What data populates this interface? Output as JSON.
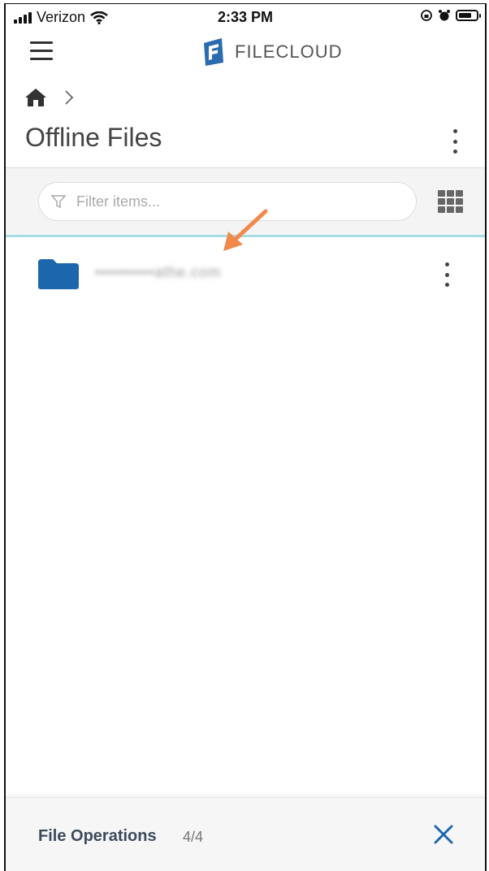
{
  "status_bar": {
    "carrier": "Verizon",
    "time": "2:33 PM"
  },
  "brand": {
    "name": "FILECLOUD"
  },
  "page": {
    "title": "Offline Files"
  },
  "filter": {
    "placeholder": "Filter items..."
  },
  "files": [
    {
      "name": "••••••••••athe.com",
      "type": "folder",
      "icon": "folder-icon"
    }
  ],
  "file_operations": {
    "label": "File Operations",
    "count": "4/4"
  },
  "colors": {
    "folder": "#1c66ad",
    "accent_line": "#a8dde6",
    "close": "#1c66ad",
    "arrow": "#f08a4b",
    "brand": "#2b6cb0"
  }
}
